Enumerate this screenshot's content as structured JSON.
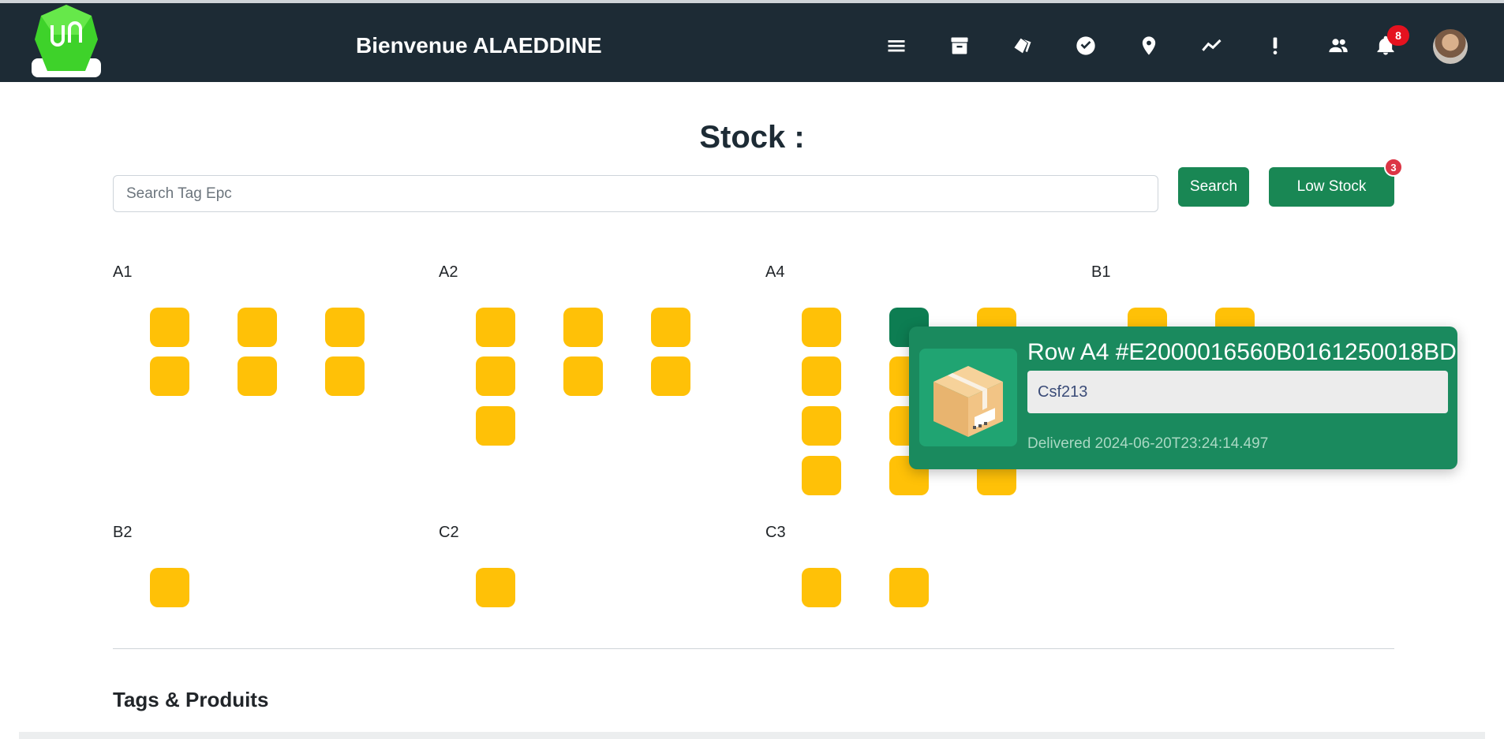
{
  "header": {
    "welcome": "Bienvenue ALAEDDINE",
    "notification_count": "8",
    "icons": [
      "menu-icon",
      "archive-icon",
      "tags-icon",
      "check-circle-icon",
      "location-pin-icon",
      "trend-line-icon",
      "alert-icon",
      "users-icon",
      "bell-icon"
    ]
  },
  "page": {
    "title": "Stock :",
    "search_placeholder": "Search Tag Epc",
    "search_button": "Search",
    "low_stock_button": "Low Stock",
    "low_stock_count": "3"
  },
  "zones": [
    {
      "label": "A1",
      "slots": 6
    },
    {
      "label": "A2",
      "slots": 7
    },
    {
      "label": "A4",
      "slots": 12
    },
    {
      "label": "B1",
      "slots": 2
    },
    {
      "label": "B2",
      "slots": 1
    },
    {
      "label": "C2",
      "slots": 1
    },
    {
      "label": "C3",
      "slots": 2
    }
  ],
  "popup": {
    "title": "Row A4 #E2000016560B0161250018BD",
    "field_value": "Csf213",
    "status": "Delivered 2024-06-20T23:24:14.497"
  },
  "footer": {
    "section_title": "Tags & Produits"
  },
  "colors": {
    "navbar": "#1d2b35",
    "slot": "#ffc107",
    "slot_selected": "#0d7d52",
    "button": "#198754",
    "popup": "#1a8a5e",
    "badge": "#e5121f"
  }
}
